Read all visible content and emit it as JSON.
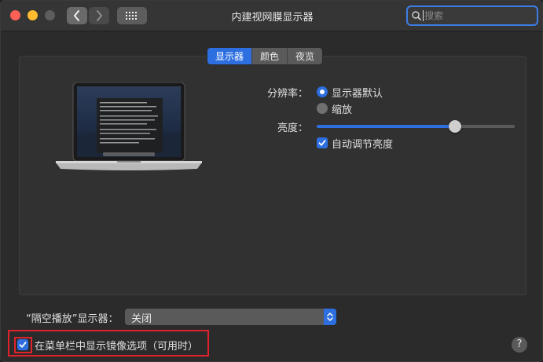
{
  "window": {
    "title": "内建视网膜显示器"
  },
  "search": {
    "placeholder": "搜索"
  },
  "tabs": [
    {
      "label": "显示器",
      "active": true
    },
    {
      "label": "颜色",
      "active": false
    },
    {
      "label": "夜览",
      "active": false
    }
  ],
  "resolution": {
    "label": "分辨率：",
    "options": [
      {
        "label": "显示器默认",
        "selected": true
      },
      {
        "label": "缩放",
        "selected": false
      }
    ]
  },
  "brightness": {
    "label": "亮度：",
    "level": 0.7,
    "auto_label": "自动调节亮度",
    "auto_checked": true
  },
  "airplay": {
    "label": "“隔空播放”显示器：",
    "value": "关闭"
  },
  "mirror_option": {
    "label": "在菜单栏中显示镜像选项（可用时）",
    "checked": true
  },
  "help": {
    "label": "?"
  },
  "colors": {
    "accent": "#2d6fe0",
    "highlight": "#e0232b"
  }
}
